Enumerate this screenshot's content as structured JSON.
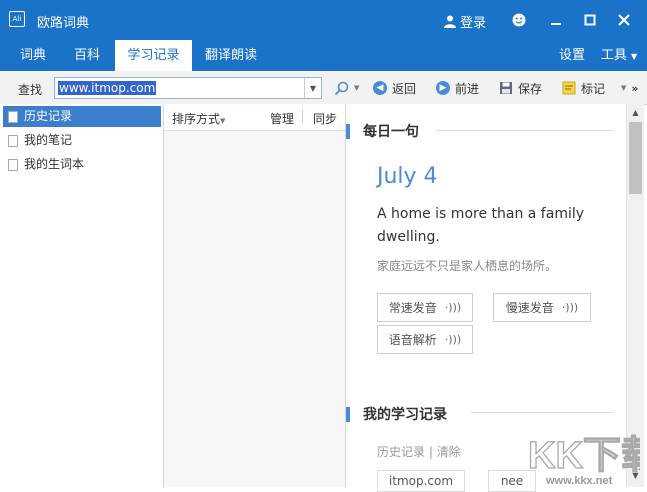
{
  "window": {
    "icon_text": "Ali",
    "title": "欧路词典",
    "login_label": "登录"
  },
  "tabs": [
    {
      "label": "词典"
    },
    {
      "label": "百科"
    },
    {
      "label": "学习记录"
    },
    {
      "label": "翻译朗读"
    }
  ],
  "top_right": {
    "settings_label": "设置",
    "tools_label": "工具"
  },
  "toolbar": {
    "lookup_label": "查找",
    "search_value": "www.itmop.com",
    "back_label": "返回",
    "forward_label": "前进",
    "save_label": "保存",
    "mark_label": "标记"
  },
  "left_panel": {
    "items": [
      {
        "label": "历史记录"
      },
      {
        "label": "我的笔记"
      },
      {
        "label": "我的生词本"
      }
    ]
  },
  "middle_panel": {
    "sort_label": "排序方式",
    "manage_label": "管理",
    "sync_label": "同步"
  },
  "daily": {
    "section_title": "每日一句",
    "date": "July 4",
    "sentence_en": "A home is more than a family dwelling.",
    "sentence_zh": "家庭远远不只是家人栖息的场所。",
    "normal_speed_label": "常速发音",
    "slow_speed_label": "慢速发音",
    "analysis_label": "语音解析"
  },
  "records": {
    "section_title": "我的学习记录",
    "history_link": "历史记录",
    "separator": "|",
    "clear_link": "清除",
    "chips": [
      "itmop.com",
      "nee"
    ]
  },
  "watermark": {
    "logo_text": "KK下载",
    "url": "www.kkx.net"
  },
  "colors": {
    "brand_blue": "#1a73c9",
    "accent_blue": "#4a8cd6",
    "selected_blue": "#3b7fcc"
  }
}
